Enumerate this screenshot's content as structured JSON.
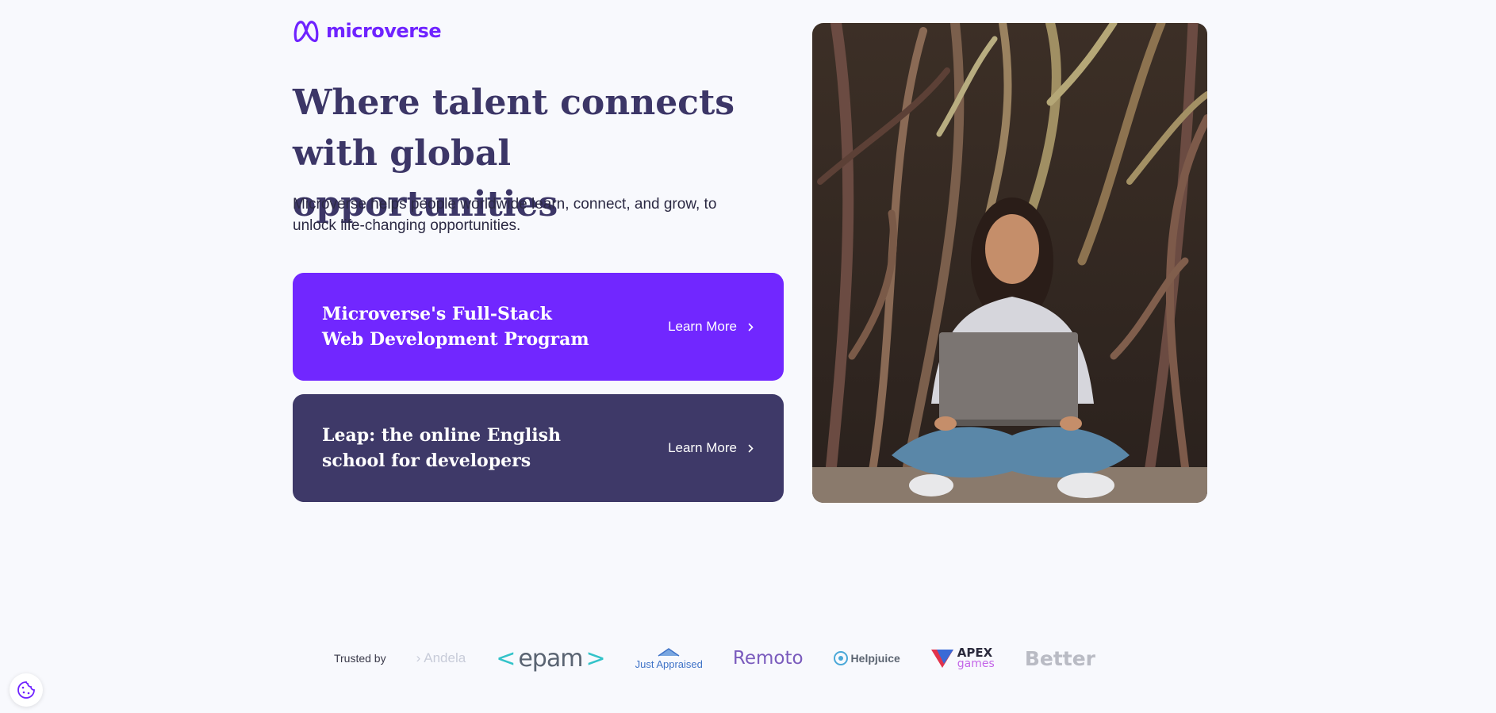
{
  "brand": {
    "name": "microverse",
    "color": "#6f23ff"
  },
  "hero": {
    "title": "Where talent connects with global opportunities",
    "subtitle": "Microverse helps people worldwide learn, connect, and grow, to unlock life-changing opportunities."
  },
  "cards": [
    {
      "title": "Microverse's Full-Stack Web Development Program",
      "cta": "Learn More",
      "background": "#7127ff"
    },
    {
      "title": "Leap: the online English school for developers",
      "cta": "Learn More",
      "background": "#3e3968"
    }
  ],
  "photo": {
    "icon": "photo-person-with-laptop"
  },
  "trusted": {
    "label": "Trusted by",
    "logos": {
      "andela": "Andela",
      "epam": "epam",
      "just_appraised": "Just Appraised",
      "remoto": "Remoto",
      "helpjuice": "Helpjuice",
      "apex_top": "APEX",
      "apex_bottom": "games",
      "better": "Better"
    }
  },
  "cookie": {
    "icon": "cookie-icon"
  }
}
